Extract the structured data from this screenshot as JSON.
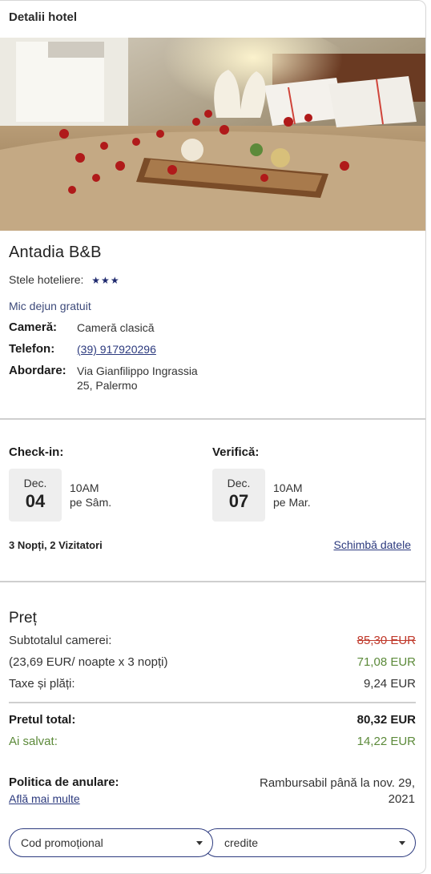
{
  "header": {
    "title": "Detalii hotel"
  },
  "hotel": {
    "name": "Antadia B&B",
    "stars_label": "Stele hoteliere:",
    "stars": "★★★",
    "breakfast": "Mic dejun gratuit",
    "room_label": "Cameră:",
    "room_value": "Cameră clasică",
    "phone_label": "Telefon:",
    "phone_value": "(39) 917920296",
    "address_label": "Abordare:",
    "address_value": "Via Gianfilippo Ingrassia 25, Palermo"
  },
  "stay": {
    "checkin_label": "Check-in:",
    "checkin_month": "Dec.",
    "checkin_day": "04",
    "checkin_time": "10AM",
    "checkin_weekday": "pe Sâm.",
    "checkout_label": "Verifică:",
    "checkout_month": "Dec.",
    "checkout_day": "07",
    "checkout_time": "10AM",
    "checkout_weekday": "pe Mar.",
    "summary": "3 Nopți, 2 Vizitatori",
    "change_dates": "Schimbă datele"
  },
  "price": {
    "title": "Preț",
    "subtotal_label": "Subtotalul camerei:",
    "subtotal_old": "85,30 EUR",
    "per_night_label": "(23,69 EUR/ noapte x 3 nopți)",
    "per_night_value": "71,08 EUR",
    "taxes_label": "Taxe și plăți:",
    "taxes_value": "9,24 EUR",
    "total_label": "Pretul total:",
    "total_value": "80,32 EUR",
    "saved_label": "Ai salvat:",
    "saved_value": "14,22 EUR"
  },
  "policy": {
    "label": "Politica de anulare:",
    "link": "Află mai multe",
    "value": "Rambursabil până la nov. 29, 2021"
  },
  "selects": {
    "promo": "Cod promoțional",
    "credits": "credite"
  },
  "colors": {
    "accent": "#2c3a7e",
    "strike": "#c0392b",
    "green": "#5c8a3a"
  }
}
